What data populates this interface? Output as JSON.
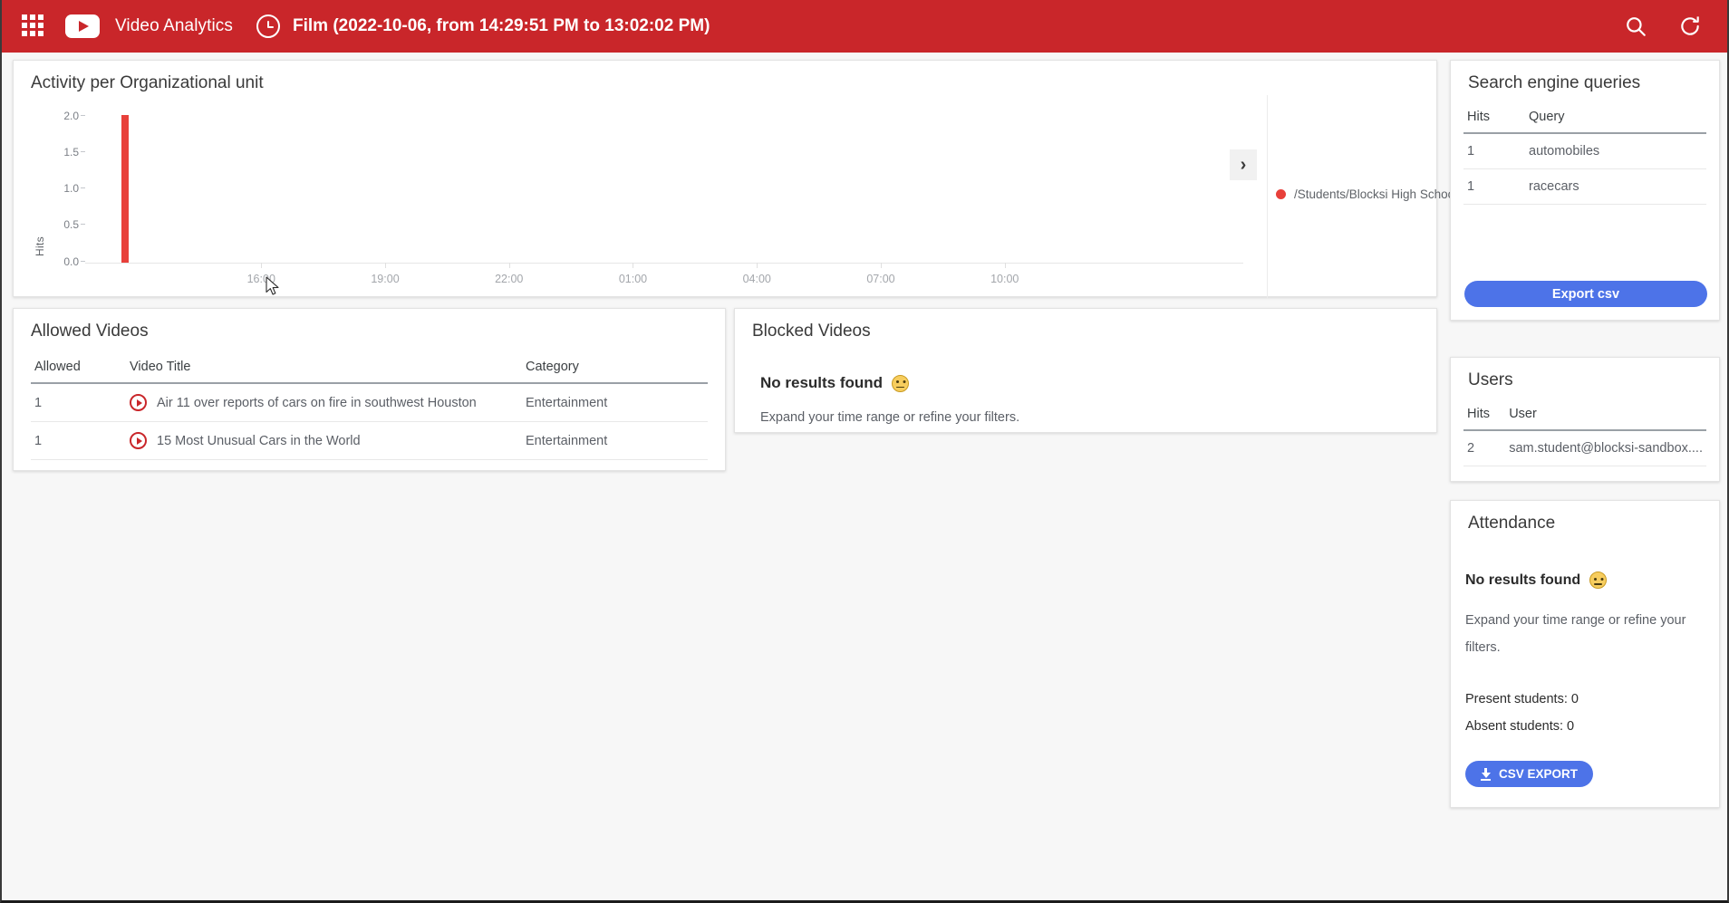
{
  "topbar": {
    "apps_icon": "apps-grid-icon",
    "brand_icon": "youtube-play-icon",
    "app_title": "Video Analytics",
    "clock_icon": "clock-icon",
    "range_title": "Film (2022-10-06, from 14:29:51 PM to 13:02:02 PM)",
    "search_icon": "search-icon",
    "refresh_icon": "refresh-icon",
    "background_color": "#c9262a"
  },
  "activity": {
    "title": "Activity per Organizational unit",
    "expand_icon": "chevron-right-icon",
    "legend": [
      {
        "label": "/Students/Blocksi High School",
        "color": "#e8403a"
      }
    ]
  },
  "chart_data": {
    "type": "bar",
    "title": "Activity per Organizational unit",
    "xlabel": "",
    "ylabel": "Hits",
    "ylim": [
      0,
      2
    ],
    "yticks": [
      "0.0",
      "0.5",
      "1.0",
      "1.5",
      "2.0"
    ],
    "xticks": [
      "16:00",
      "19:00",
      "22:00",
      "01:00",
      "04:00",
      "07:00",
      "10:00"
    ],
    "xtick_positions_pct": [
      15.2,
      25.9,
      36.6,
      47.3,
      58.0,
      68.7,
      79.4
    ],
    "grid": false,
    "legend_position": "right",
    "series": [
      {
        "name": "/Students/Blocksi High School",
        "color": "#e8403a",
        "x": [
          "14:30"
        ],
        "values": [
          2
        ],
        "bar_positions_pct": [
          3.1
        ]
      }
    ]
  },
  "search_queries": {
    "title": "Search engine queries",
    "columns": [
      "Hits",
      "Query"
    ],
    "rows": [
      {
        "hits": "1",
        "query": "automobiles"
      },
      {
        "hits": "1",
        "query": "racecars"
      }
    ],
    "export_label": "Export csv",
    "export_color": "#4d73e8"
  },
  "users": {
    "title": "Users",
    "columns": [
      "Hits",
      "User"
    ],
    "rows": [
      {
        "hits": "2",
        "user": "sam.student@blocksi-sandbox...."
      }
    ]
  },
  "attendance": {
    "title": "Attendance",
    "empty_title": "No results found",
    "empty_icon": "neutral-face-icon",
    "empty_sub": "Expand your time range or refine your filters.",
    "present_label": "Present students: 0",
    "absent_label": "Absent students: 0",
    "csv_label": "CSV EXPORT",
    "csv_icon": "download-icon"
  },
  "allowed_videos": {
    "title": "Allowed Videos",
    "columns": [
      "Allowed",
      "Video Title",
      "Category"
    ],
    "rows": [
      {
        "allowed": "1",
        "icon": "play-circle-icon",
        "title": "Air 11 over reports of cars on fire in southwest Houston",
        "category": "Entertainment"
      },
      {
        "allowed": "1",
        "icon": "play-circle-icon",
        "title": "15 Most Unusual Cars in the World",
        "category": "Entertainment"
      }
    ]
  },
  "blocked_videos": {
    "title": "Blocked Videos",
    "empty_title": "No results found",
    "empty_icon": "neutral-face-icon",
    "empty_sub": "Expand your time range or refine your filters."
  }
}
